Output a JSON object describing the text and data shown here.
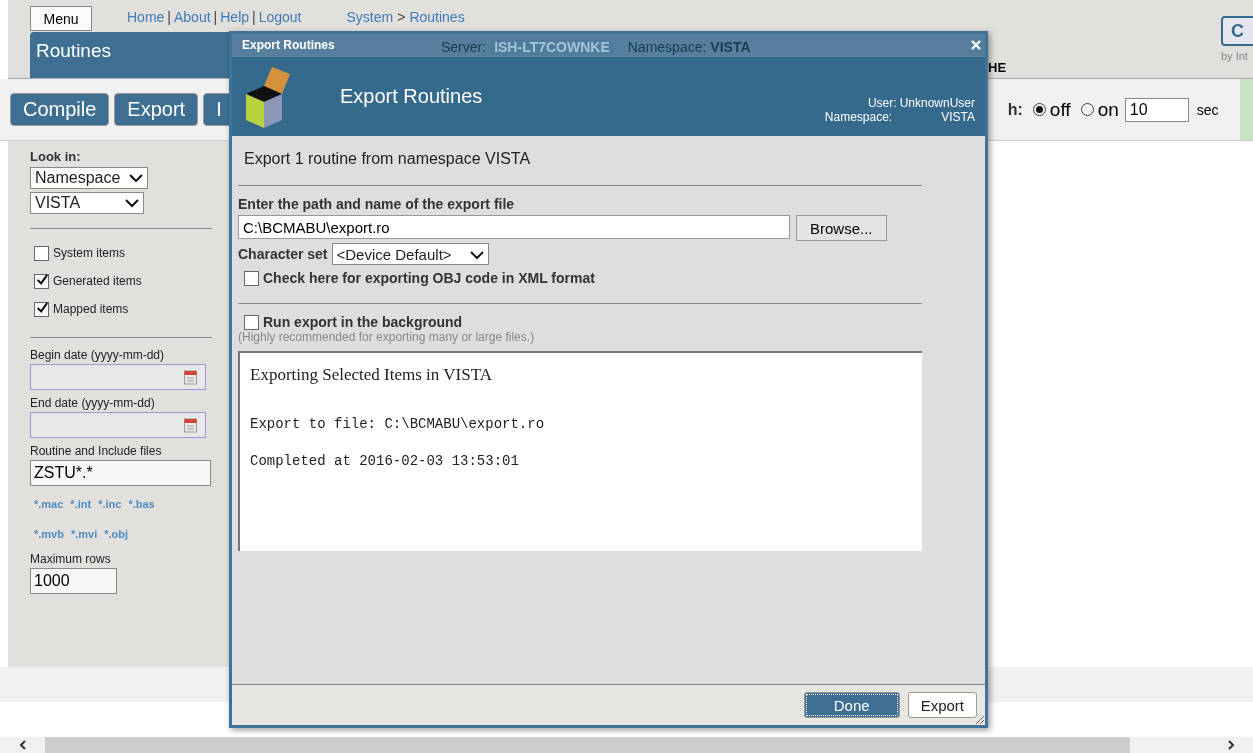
{
  "top_bar": {
    "menu_button": "Menu",
    "links": [
      "Home",
      "About",
      "Help",
      "Logout"
    ],
    "link_separator": "|",
    "breadcrumb": [
      "System",
      "Routines"
    ],
    "breadcrumb_separator": ">",
    "corner_button": "C",
    "corner_caption": "by Int"
  },
  "header": {
    "title": "Routines",
    "server_label": "Server:",
    "server": "ISH-LT7COWNKE",
    "namespace_label": "Namespace:",
    "namespace": "VISTA",
    "column_3": "HE"
  },
  "toolbar": {
    "buttons": [
      "Compile",
      "Export",
      "I"
    ],
    "refresh_label": "h:",
    "refresh_options": [
      {
        "label": "off",
        "selected": true
      },
      {
        "label": "on",
        "selected": false
      }
    ],
    "interval": "10",
    "unit": "sec"
  },
  "sidebar": {
    "look_in_label": "Look in:",
    "look_in": "Namespace",
    "namespace": "VISTA",
    "options": [
      {
        "label": "System items",
        "checked": false
      },
      {
        "label": "Generated items",
        "checked": true
      },
      {
        "label": "Mapped items",
        "checked": true
      }
    ],
    "begin_date_label": "Begin date (yyyy-mm-dd)",
    "end_date_label": "End date (yyyy-mm-dd)",
    "files_label": "Routine and Include files",
    "files_value": "ZSTU*.*",
    "filters": [
      [
        "*.mac",
        "*.int",
        "*.inc",
        "*.bas"
      ],
      [
        "*.mvb",
        "*.mvi",
        "*.obj"
      ]
    ],
    "max_rows_label": "Maximum rows",
    "max_rows": "1000"
  },
  "dialog": {
    "title": "Export Routines",
    "heading": "Export Routines",
    "user_label": "User:",
    "user": "UnknownUser",
    "namespace_label": "Namespace:",
    "namespace": "VISTA",
    "summary": "Export 1 routine from namespace VISTA",
    "path_label": "Enter the path and name of the export file",
    "path": "C:\\BCMABU\\export.ro",
    "browse": "Browse...",
    "charset_label": "Character set",
    "charset": "<Device Default>",
    "xml_option": {
      "label": "Check here for exporting OBJ code in XML format",
      "checked": false
    },
    "background_option": {
      "label": "Run export in the background",
      "checked": false
    },
    "background_hint": "(Highly recommended for exporting many or large files.)",
    "output_title": "Exporting Selected Items in VISTA",
    "output_lines": [
      "Export to file: C:\\BCMABU\\export.ro",
      "Completed at 2016-02-03 13:53:01"
    ],
    "buttons": [
      {
        "label": "Done",
        "kind": "primary"
      },
      {
        "label": "Export",
        "kind": "plain"
      }
    ]
  }
}
